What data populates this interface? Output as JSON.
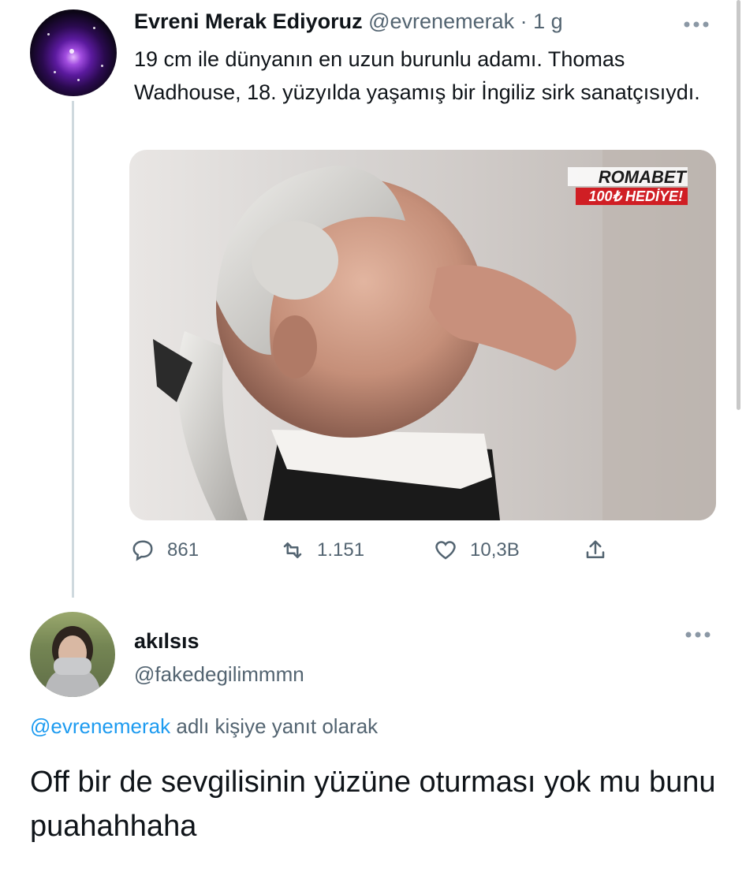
{
  "tweet": {
    "author_name": "Evreni Merak Ediyoruz",
    "author_handle": "@evrenemerak",
    "separator": "·",
    "time": "1 g",
    "more_icon": "more-horizontal-icon",
    "text": "19 cm ile dünyanın en uzun burunlu adamı. Thomas Wadhouse, 18. yüzyılda yaşamış bir İngiliz sirk sanatçısıydı.",
    "media": {
      "watermark_brand": "ROMABET",
      "watermark_tag": "100₺ HEDİYE!"
    },
    "actions": {
      "reply_count": "861",
      "retweet_count": "1.151",
      "like_count": "10,3B",
      "reply_icon": "comment-icon",
      "retweet_icon": "retweet-icon",
      "like_icon": "heart-icon",
      "share_icon": "share-icon"
    }
  },
  "reply": {
    "author_name": "akılsıs",
    "author_handle": "@fakedegilimmmn",
    "replying_to_handle": "@evrenemerak",
    "replying_to_suffix": "adlı kişiye yanıt olarak",
    "text": "Off bir de sevgilisinin yüzüne oturması yok mu bunu puahahhaha"
  },
  "colors": {
    "link": "#1d9bf0",
    "muted": "#536471",
    "text": "#0f1419"
  }
}
